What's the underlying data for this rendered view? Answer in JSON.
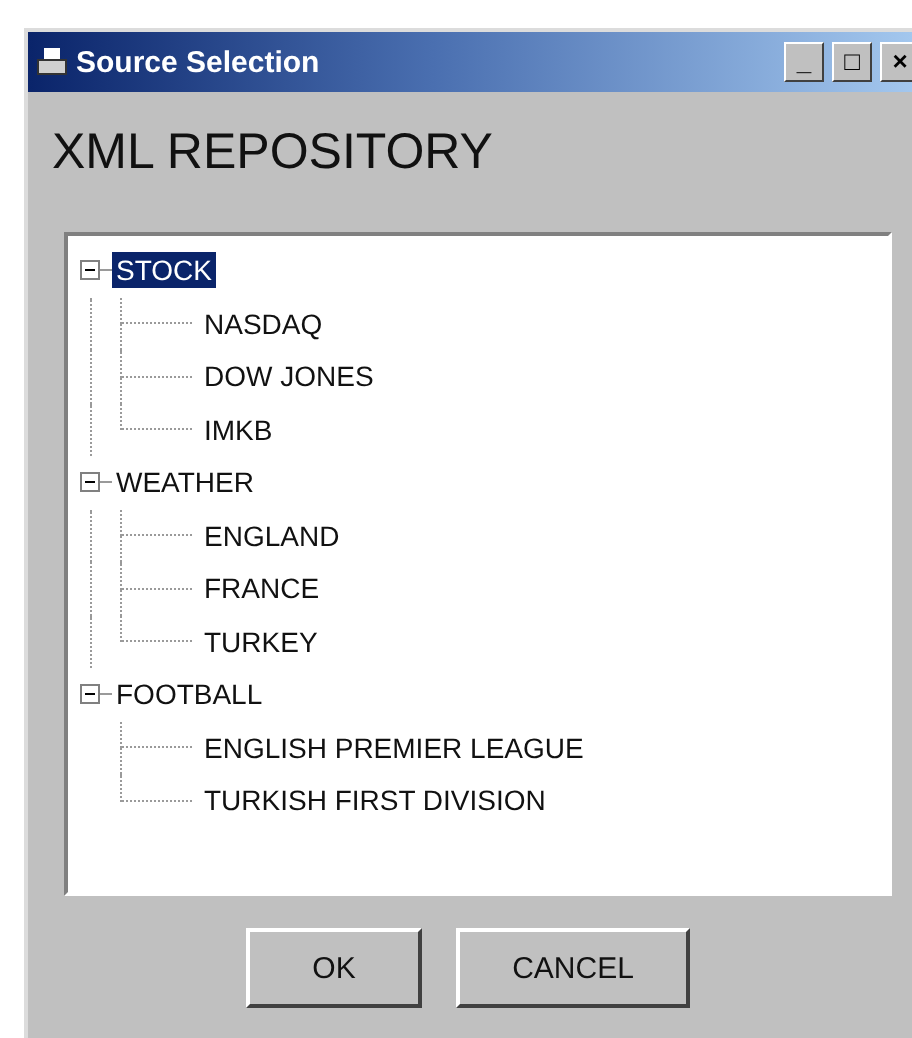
{
  "window": {
    "title": "Source Selection",
    "controls": [
      "_",
      "□",
      "×"
    ]
  },
  "heading": "XML REPOSITORY",
  "tree": [
    {
      "label": "STOCK",
      "selected": true,
      "expanded": true,
      "children": [
        {
          "label": "NASDAQ",
          "selected": false
        },
        {
          "label": "DOW JONES",
          "selected": false
        },
        {
          "label": "IMKB",
          "selected": false
        }
      ]
    },
    {
      "label": "WEATHER",
      "selected": false,
      "expanded": true,
      "children": [
        {
          "label": "ENGLAND",
          "selected": false
        },
        {
          "label": "FRANCE",
          "selected": false
        },
        {
          "label": "TURKEY",
          "selected": false
        }
      ]
    },
    {
      "label": "FOOTBALL",
      "selected": false,
      "expanded": true,
      "children": [
        {
          "label": "ENGLISH PREMIER LEAGUE",
          "selected": false
        },
        {
          "label": "TURKISH FIRST DIVISION",
          "selected": false
        }
      ]
    }
  ],
  "buttons": [
    "OK",
    "CANCEL"
  ]
}
